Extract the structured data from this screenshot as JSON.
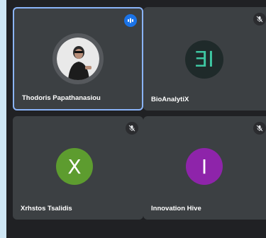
{
  "participants": [
    {
      "name": "Thodoris Papathanasiou",
      "initial": "",
      "avatar_type": "photo",
      "status_icon": "speaking-icon",
      "active": true
    },
    {
      "name": "BioAnalytiX",
      "initial": "ƎI",
      "avatar_type": "logo",
      "status_icon": "mic-off-icon",
      "active": false,
      "color": "#1f2a2a",
      "logo_color": "#3ec7a2"
    },
    {
      "name": "Xrhstos Tsalidis",
      "initial": "X",
      "avatar_type": "initial",
      "status_icon": "mic-off-icon",
      "active": false,
      "color": "#5d9c2f"
    },
    {
      "name": "Innovation Hive",
      "initial": "I",
      "avatar_type": "initial",
      "status_icon": "mic-off-icon",
      "active": false,
      "color": "#8e24aa"
    }
  ]
}
